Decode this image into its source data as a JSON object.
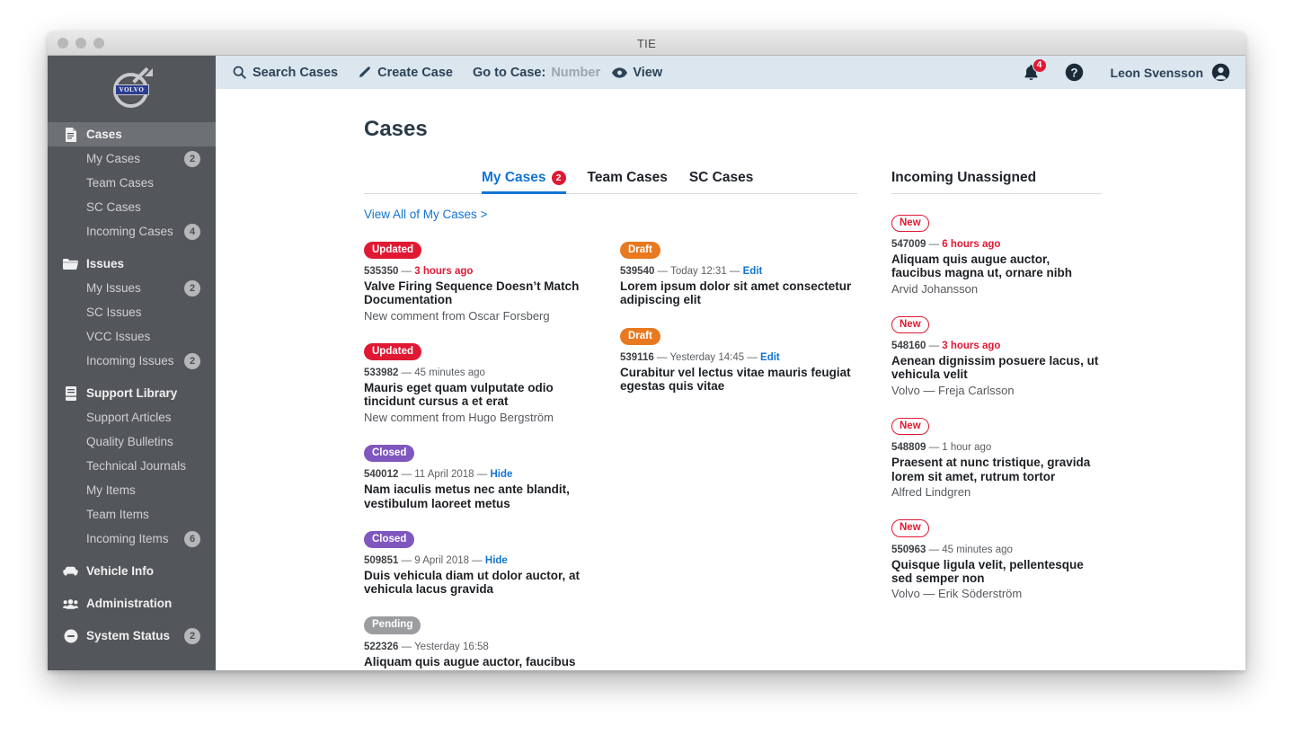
{
  "window": {
    "title": "TIE",
    "traffic_lights": [
      "close",
      "minimize",
      "zoom"
    ]
  },
  "sidebar": {
    "logo": {
      "wordmark": "VOLVO"
    },
    "items": [
      {
        "label": "Cases",
        "icon": "document-icon",
        "type": "group",
        "active": true
      },
      {
        "label": "My Cases",
        "type": "sub",
        "badge": "2"
      },
      {
        "label": "Team Cases",
        "type": "sub"
      },
      {
        "label": "SC Cases",
        "type": "sub"
      },
      {
        "label": "Incoming Cases",
        "type": "sub",
        "badge": "4"
      },
      {
        "label": "Issues",
        "icon": "folder-icon",
        "type": "group"
      },
      {
        "label": "My Issues",
        "type": "sub",
        "badge": "2"
      },
      {
        "label": "SC Issues",
        "type": "sub"
      },
      {
        "label": "VCC Issues",
        "type": "sub"
      },
      {
        "label": "Incoming Issues",
        "type": "sub",
        "badge": "2"
      },
      {
        "label": "Support Library",
        "icon": "book-icon",
        "type": "group"
      },
      {
        "label": "Support Articles",
        "type": "sub"
      },
      {
        "label": "Quality Bulletins",
        "type": "sub"
      },
      {
        "label": "Technical Journals",
        "type": "sub"
      },
      {
        "label": "My Items",
        "type": "sub"
      },
      {
        "label": "Team Items",
        "type": "sub"
      },
      {
        "label": "Incoming Items",
        "type": "sub",
        "badge": "6"
      },
      {
        "label": "Vehicle Info",
        "icon": "car-icon",
        "type": "group"
      },
      {
        "label": "Administration",
        "icon": "people-icon",
        "type": "group"
      },
      {
        "label": "System Status",
        "icon": "minus-circle-icon",
        "type": "group",
        "badge": "2"
      }
    ]
  },
  "toolbar": {
    "search_label": "Search Cases",
    "create_label": "Create Case",
    "goto_label": "Go to Case:",
    "goto_placeholder": "Number",
    "goto_value": "",
    "view_label": "View",
    "notifications_count": "4",
    "user_name": "Leon Svensson"
  },
  "main": {
    "page_title": "Cases",
    "tabs": [
      {
        "label": "My Cases",
        "badge": "2",
        "active": true
      },
      {
        "label": "Team Cases",
        "active": false
      },
      {
        "label": "SC Cases",
        "active": false
      }
    ],
    "right_column_heading": "Incoming Unassigned",
    "view_all_link": "View All of My Cases >",
    "column_a": [
      {
        "badge": "Updated",
        "badge_type": "updated",
        "number": "535350",
        "sep": "—",
        "time": "3 hours ago",
        "time_hot": true,
        "title": "Valve Firing Sequence Doesn’t Match Documentation",
        "sub": "New comment from Oscar Forsberg"
      },
      {
        "badge": "Updated",
        "badge_type": "updated",
        "number": "533982",
        "sep": "—",
        "time": "45 minutes ago",
        "time_hot": false,
        "title": "Mauris eget quam vulputate odio tincidunt cursus a et erat",
        "sub": "New comment from Hugo Bergström"
      },
      {
        "badge": "Closed",
        "badge_type": "closed",
        "number": "540012",
        "sep": "—",
        "time": "11 April 2018",
        "time_hot": false,
        "action": "Hide",
        "title": "Nam iaculis metus nec ante blandit, vestibulum laoreet metus",
        "sub": ""
      },
      {
        "badge": "Closed",
        "badge_type": "closed",
        "number": "509851",
        "sep": "—",
        "time": "9 April 2018",
        "time_hot": false,
        "action": "Hide",
        "title": "Duis vehicula diam ut dolor auctor, at vehicula lacus gravida",
        "sub": ""
      },
      {
        "badge": "Pending",
        "badge_type": "pending",
        "number": "522326",
        "sep": "—",
        "time": "Yesterday 16:58",
        "time_hot": false,
        "title": "Aliquam quis augue auctor, faucibus magna ut, ornare nibh",
        "sub": ""
      }
    ],
    "column_b": [
      {
        "badge": "Draft",
        "badge_type": "draft",
        "number": "539540",
        "sep": "—",
        "time": "Today 12:31",
        "time_hot": false,
        "action": "Edit",
        "title": "Lorem ipsum dolor sit amet consectetur adipiscing elit",
        "sub": ""
      },
      {
        "badge": "Draft",
        "badge_type": "draft",
        "number": "539116",
        "sep": "—",
        "time": "Yesterday 14:45",
        "time_hot": false,
        "action": "Edit",
        "title": "Curabitur vel lectus vitae mauris feugiat egestas quis vitae",
        "sub": ""
      }
    ],
    "column_c": [
      {
        "badge": "New",
        "badge_type": "newout",
        "number": "547009",
        "sep": "—",
        "time": "6 hours ago",
        "time_hot": true,
        "title": "Aliquam quis augue auctor, faucibus magna ut, ornare nibh",
        "sub": "Arvid Johansson"
      },
      {
        "badge": "New",
        "badge_type": "newout",
        "number": "548160",
        "sep": "—",
        "time": "3 hours ago",
        "time_hot": true,
        "title": "Aenean dignissim posuere lacus, ut vehicula velit",
        "sub": "Volvo — Freja Carlsson"
      },
      {
        "badge": "New",
        "badge_type": "newout",
        "number": "548809",
        "sep": "—",
        "time": "1 hour ago",
        "time_hot": false,
        "title": "Praesent at nunc tristique, gravida lorem sit amet, rutrum tortor",
        "sub": "Alfred Lindgren"
      },
      {
        "badge": "New",
        "badge_type": "newout",
        "number": "550963",
        "sep": "—",
        "time": "45 minutes ago",
        "time_hot": false,
        "title": "Quisque ligula velit, pellentesque sed semper non",
        "sub": "Volvo — Erik Söderström"
      }
    ]
  },
  "colors": {
    "sidebar_bg": "#53565a",
    "sidebar_active": "#6d7074",
    "toolbar_bg": "#dce6ef",
    "accent_blue": "#1274d4",
    "status_red": "#e01933",
    "status_orange": "#e8791e",
    "status_purple": "#7f57be",
    "status_grey": "#9b9da0"
  }
}
